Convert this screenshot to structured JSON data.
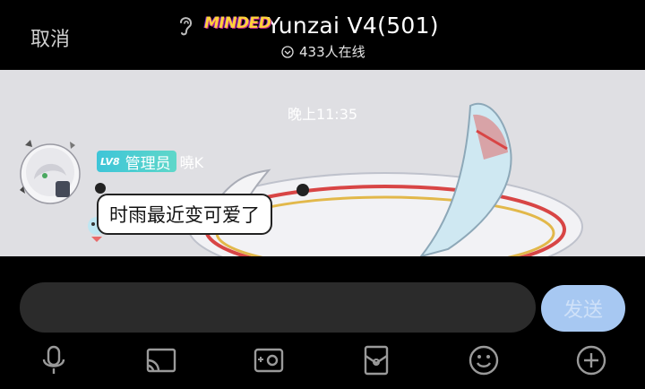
{
  "header": {
    "cancel_label": "取消",
    "logo_text": "MINDED",
    "group_name": "Yunzai V4(501)",
    "online_count": "433人在线"
  },
  "chat": {
    "timestamp": "晚上11:35",
    "messages": [
      {
        "badge_level": "LV8",
        "badge_role": "管理员",
        "sender": "曉K",
        "text": "时雨最近变可爱了"
      }
    ]
  },
  "composer": {
    "input_value": "",
    "send_label": "发送"
  },
  "toolbar": {
    "icons": [
      "microphone-icon",
      "cast-icon",
      "photo-icon",
      "red-packet-icon",
      "emoji-icon",
      "plus-icon"
    ]
  },
  "colors": {
    "background": "#000000",
    "chat_background": "#e0e0e4",
    "send_button": "#a7c8f2",
    "badge": "#3ec5d8",
    "logo_yellow": "#ffd23a"
  }
}
